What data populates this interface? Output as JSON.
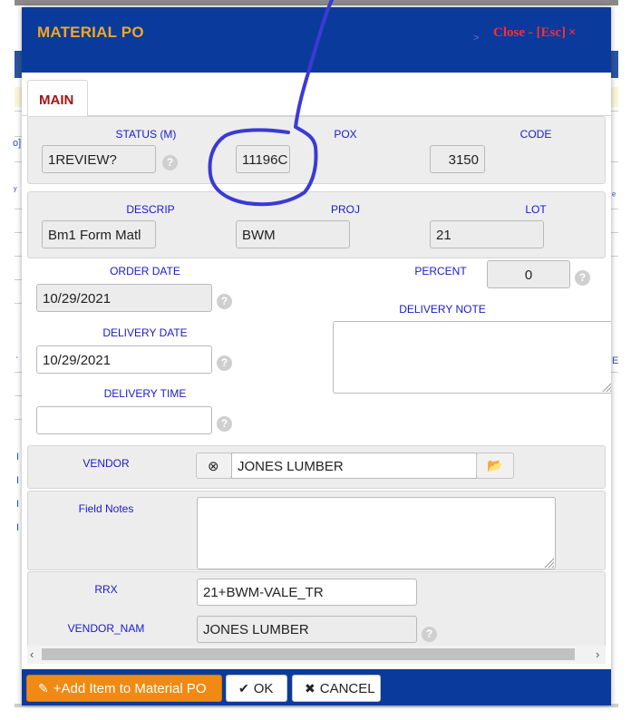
{
  "background": {
    "glyphs": [
      "o]",
      "ʸ",
      "ʿ",
      "ᵉ",
      "E",
      "I",
      "I",
      "I",
      "I"
    ]
  },
  "dialog": {
    "title": "MATERIAL PO",
    "close_label": "Close - [Esc]",
    "close_icon": "×",
    "close_marker": ">",
    "header_color": "#0a3a9c",
    "title_color": "#f5a623",
    "close_color": "#ff2d2d"
  },
  "tabs": [
    {
      "label": "MAIN",
      "active": true
    }
  ],
  "fields": {
    "status": {
      "label": "STATUS (M)",
      "value": "1REVIEW?"
    },
    "pox": {
      "label": "POX",
      "value": "11196C"
    },
    "code": {
      "label": "CODE",
      "value": "3150"
    },
    "descrip": {
      "label": "DESCRIP",
      "value": "Bm1 Form Matl"
    },
    "proj": {
      "label": "PROJ",
      "value": "BWM"
    },
    "lot": {
      "label": "LOT",
      "value": "21"
    },
    "order_date": {
      "label": "ORDER DATE",
      "value": "10/29/2021"
    },
    "percent": {
      "label": "PERCENT",
      "value": "0"
    },
    "delivery_date": {
      "label": "DELIVERY DATE",
      "value": "10/29/2021"
    },
    "delivery_note": {
      "label": "DELIVERY NOTE",
      "value": ""
    },
    "delivery_time": {
      "label": "DELIVERY TIME",
      "value": ""
    },
    "vendor": {
      "label": "VENDOR",
      "value": "JONES LUMBER"
    },
    "field_notes": {
      "label": "Field Notes",
      "value": ""
    },
    "rrx": {
      "label": "RRX",
      "value": "21+BWM-VALE_TR"
    },
    "vendor_nam": {
      "label": "VENDOR_NAM",
      "value": "JONES LUMBER"
    }
  },
  "help_glyph": "?",
  "footer": {
    "add_label": "+Add Item to Material PO",
    "ok_label": "OK",
    "cancel_label": "CANCEL",
    "add_color": "#f08a14"
  },
  "icons": {
    "pencil": "✎",
    "check": "✔",
    "cross": "✖",
    "clear": "⊗",
    "folder": "📂",
    "scroll_left": "‹",
    "scroll_right": "›"
  },
  "annotation": {
    "color": "#3a3ad6",
    "kind": "hand-drawn circle around POX value"
  }
}
